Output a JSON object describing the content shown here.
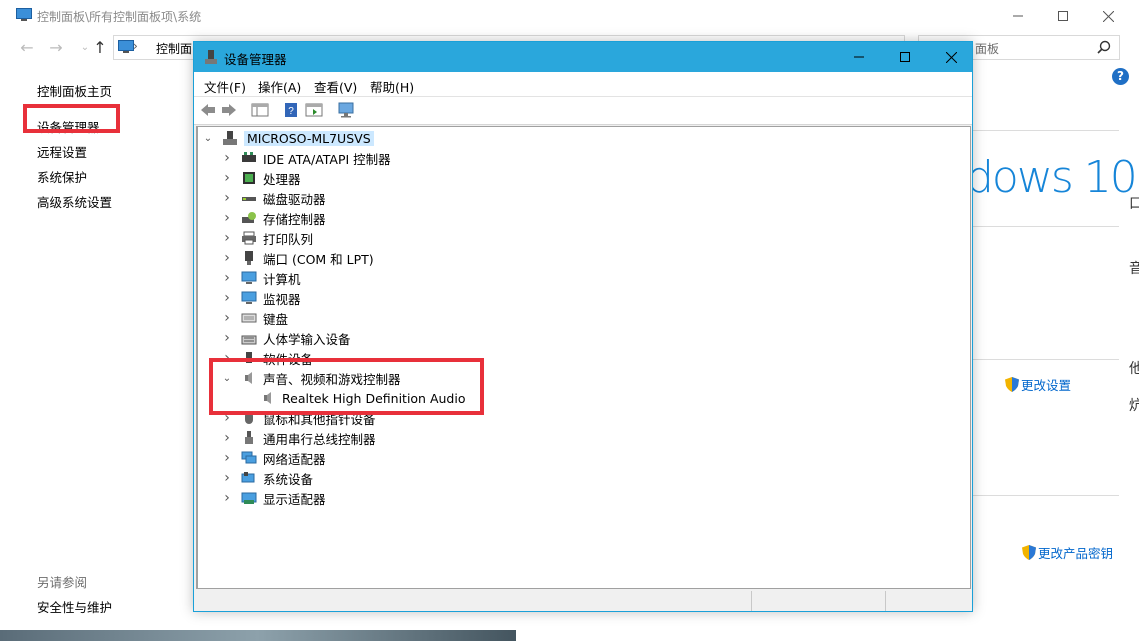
{
  "control_panel": {
    "title": "控制面板\\所有控制面板项\\系统",
    "address": "控制面",
    "search_placeholder": "面板",
    "sidebar": {
      "home": "控制面板主页",
      "device_manager": "设备管理器",
      "remote": "远程设置",
      "protection": "系统保护",
      "advanced": "高级系统设置",
      "see_also": "另请参阅",
      "security": "安全性与维护"
    },
    "main": {
      "windows_logo_text": "dows 10",
      "change_settings": "更改设置",
      "change_product_key": "更改产品密钥"
    },
    "edge_glyphs": [
      "口",
      "音",
      "他",
      "炕"
    ]
  },
  "device_manager": {
    "title": "设备管理器",
    "menu": {
      "file": "文件(F)",
      "action": "操作(A)",
      "view": "查看(V)",
      "help": "帮助(H)"
    },
    "root": "MICROSO-ML7USVS",
    "categories": [
      {
        "label": "IDE ATA/ATAPI 控制器",
        "icon": "ide-controller-icon",
        "expanded": false
      },
      {
        "label": "处理器",
        "icon": "processor-icon",
        "expanded": false
      },
      {
        "label": "磁盘驱动器",
        "icon": "disk-drive-icon",
        "expanded": false
      },
      {
        "label": "存储控制器",
        "icon": "storage-controller-icon",
        "expanded": false
      },
      {
        "label": "打印队列",
        "icon": "printer-icon",
        "expanded": false
      },
      {
        "label": "端口 (COM 和 LPT)",
        "icon": "port-icon",
        "expanded": false
      },
      {
        "label": "计算机",
        "icon": "computer-icon",
        "expanded": false
      },
      {
        "label": "监视器",
        "icon": "monitor-icon",
        "expanded": false
      },
      {
        "label": "键盘",
        "icon": "keyboard-icon",
        "expanded": false
      },
      {
        "label": "人体学输入设备",
        "icon": "hid-icon",
        "expanded": false
      },
      {
        "label": "软件设备",
        "icon": "software-device-icon",
        "expanded": false
      },
      {
        "label": "声音、视频和游戏控制器",
        "icon": "speaker-icon",
        "expanded": true
      },
      {
        "label": "鼠标和其他指针设备",
        "icon": "mouse-icon",
        "expanded": false
      },
      {
        "label": "通用串行总线控制器",
        "icon": "usb-icon",
        "expanded": false
      },
      {
        "label": "网络适配器",
        "icon": "network-adapter-icon",
        "expanded": false
      },
      {
        "label": "系统设备",
        "icon": "system-device-icon",
        "expanded": false
      },
      {
        "label": "显示适配器",
        "icon": "display-adapter-icon",
        "expanded": false
      }
    ],
    "sound_child": "Realtek High Definition Audio"
  },
  "colors": {
    "titlebar_accent": "#2aa7dc",
    "highlight_box": "#e8303a",
    "link": "#0066cc",
    "windows_logo": "#1685d8"
  }
}
